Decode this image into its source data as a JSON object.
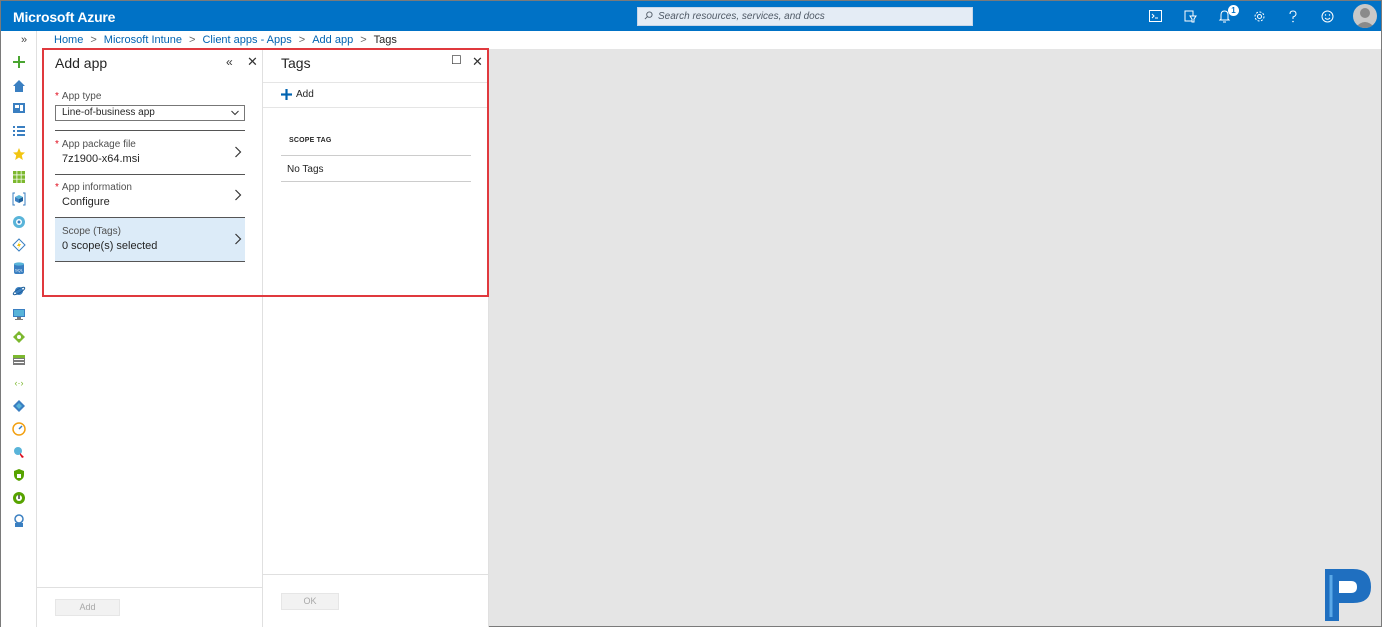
{
  "topbar": {
    "brand": "Microsoft Azure",
    "search_placeholder": "Search resources, services, and docs",
    "notification_count": "1",
    "icons": [
      "cloud-shell-icon",
      "directory-filter-icon",
      "notifications-icon",
      "settings-icon",
      "help-icon",
      "feedback-icon",
      "avatar"
    ]
  },
  "breadcrumb": {
    "items": [
      "Home",
      "Microsoft Intune",
      "Client apps - Apps",
      "Add app"
    ],
    "current": "Tags",
    "separator": ">"
  },
  "leftnav": {
    "expand_label": "»",
    "icons": [
      "create-resource-icon",
      "home-icon",
      "dashboard-icon",
      "all-services-icon",
      "favorites-star-icon",
      "all-resources-icon",
      "resource-groups-icon",
      "app-services-icon",
      "function-apps-icon",
      "sql-databases-icon",
      "cosmos-db-icon",
      "virtual-machines-icon",
      "load-balancers-icon",
      "storage-accounts-icon",
      "virtual-networks-icon",
      "azure-ad-icon",
      "monitor-icon",
      "advisor-icon",
      "security-center-icon",
      "cost-management-icon",
      "help-support-icon"
    ]
  },
  "add_app": {
    "title": "Add app",
    "collapse_label": "«",
    "close_label": "✕",
    "app_type": {
      "label": "App type",
      "value": "Line-of-business app"
    },
    "app_package": {
      "label": "App package file",
      "value": "7z1900-x64.msi"
    },
    "app_info": {
      "label": "App information",
      "value": "Configure"
    },
    "scope": {
      "label": "Scope (Tags)",
      "value": "0 scope(s) selected"
    },
    "add_button": "Add"
  },
  "tags": {
    "title": "Tags",
    "maximize_label": "☐",
    "close_label": "✕",
    "add_command": "Add",
    "column_header": "SCOPE TAG",
    "rows": [
      "No Tags"
    ],
    "ok_button": "OK"
  },
  "colors": {
    "topbar": "#0072c6",
    "link": "#0063b1",
    "required": "#e00b1c",
    "selected_row": "#dcebf8",
    "highlight_border": "#e0393e"
  }
}
